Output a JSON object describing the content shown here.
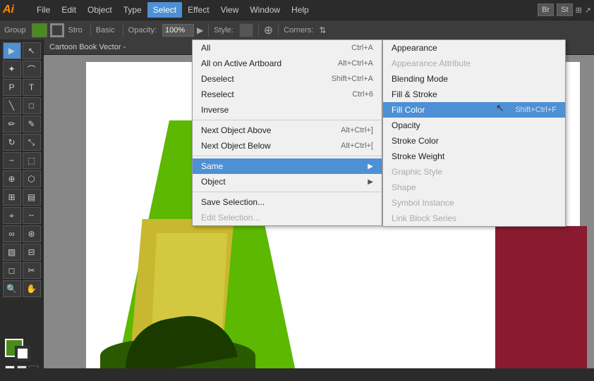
{
  "app": {
    "logo": "Ai",
    "menu_items": [
      "File",
      "Edit",
      "Object",
      "Type",
      "Select",
      "Effect",
      "View",
      "Window",
      "Help"
    ],
    "active_menu": "Select",
    "bridge_label": "Br",
    "stock_label": "St"
  },
  "toolbar": {
    "group_label": "Group",
    "color_fill": "#4a8c1c",
    "style_label": "Stro",
    "basic_label": "Basic",
    "opacity_label": "Opacity:",
    "opacity_value": "100%",
    "style2_label": "Style:",
    "corners_label": "Corners:"
  },
  "canvas_tab": {
    "title": "Cartoon Book Vector -"
  },
  "select_menu": {
    "items": [
      {
        "label": "All",
        "shortcut": "Ctrl+A",
        "disabled": false,
        "submenu": false
      },
      {
        "label": "All on Active Artboard",
        "shortcut": "Alt+Ctrl+A",
        "disabled": false,
        "submenu": false
      },
      {
        "label": "Deselect",
        "shortcut": "Shift+Ctrl+A",
        "disabled": false,
        "submenu": false
      },
      {
        "label": "Reselect",
        "shortcut": "Ctrl+6",
        "disabled": false,
        "submenu": false
      },
      {
        "label": "Inverse",
        "shortcut": "",
        "disabled": false,
        "submenu": false
      },
      {
        "label": "Next Object Above",
        "shortcut": "Alt+Ctrl+]",
        "disabled": false,
        "submenu": false
      },
      {
        "label": "Next Object Below",
        "shortcut": "Alt+Ctrl+[",
        "disabled": false,
        "submenu": false
      },
      {
        "label": "Same",
        "shortcut": "",
        "disabled": false,
        "submenu": true,
        "highlighted": true
      },
      {
        "label": "Object",
        "shortcut": "",
        "disabled": false,
        "submenu": true
      },
      {
        "label": "Save Selection...",
        "shortcut": "",
        "disabled": false,
        "submenu": false
      },
      {
        "label": "Edit Selection...",
        "shortcut": "",
        "disabled": true,
        "submenu": false
      }
    ]
  },
  "same_submenu": {
    "items": [
      {
        "label": "Appearance",
        "shortcut": "",
        "disabled": false,
        "highlighted": false
      },
      {
        "label": "Appearance Attribute",
        "shortcut": "",
        "disabled": true,
        "highlighted": false
      },
      {
        "label": "Blending Mode",
        "shortcut": "",
        "disabled": false,
        "highlighted": false
      },
      {
        "label": "Fill & Stroke",
        "shortcut": "",
        "disabled": false,
        "highlighted": false
      },
      {
        "label": "Fill Color",
        "shortcut": "Shift+Ctrl+F",
        "disabled": false,
        "highlighted": true
      },
      {
        "label": "Opacity",
        "shortcut": "",
        "disabled": false,
        "highlighted": false
      },
      {
        "label": "Stroke Color",
        "shortcut": "",
        "disabled": false,
        "highlighted": false
      },
      {
        "label": "Stroke Weight",
        "shortcut": "",
        "disabled": false,
        "highlighted": false
      },
      {
        "label": "Graphic Style",
        "shortcut": "",
        "disabled": true,
        "highlighted": false
      },
      {
        "label": "Shape",
        "shortcut": "",
        "disabled": true,
        "highlighted": false
      },
      {
        "label": "Symbol Instance",
        "shortcut": "",
        "disabled": true,
        "highlighted": false
      },
      {
        "label": "Link Block Series",
        "shortcut": "",
        "disabled": true,
        "highlighted": false
      }
    ]
  },
  "tools": {
    "items": [
      "▶",
      "◻",
      "✏",
      "P",
      "T",
      "⬡",
      "✂",
      "⭕",
      "⬛",
      "↕",
      "🔍",
      "⬚",
      "⬚",
      "⬚"
    ]
  },
  "bottom_bar": {
    "status": ""
  }
}
